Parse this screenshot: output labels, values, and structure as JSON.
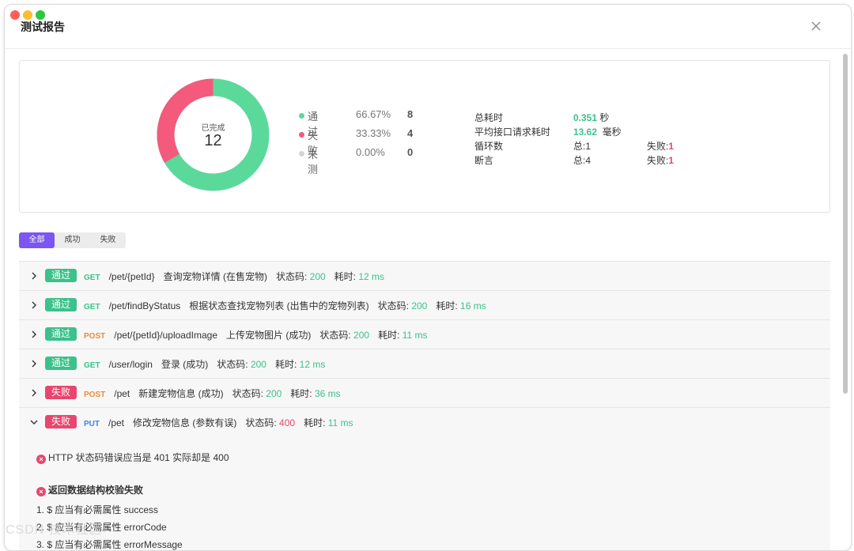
{
  "window": {
    "title": "测试报告"
  },
  "summary": {
    "center_label": "已完成",
    "center_value": "12",
    "legend": [
      {
        "name": "通过",
        "pct": "66.67%",
        "count": "8",
        "color": "#5bd99b"
      },
      {
        "name": "失败",
        "pct": "33.33%",
        "count": "4",
        "color": "#f35a7c"
      },
      {
        "name": "未测",
        "pct": "0.00%",
        "count": "0",
        "color": "#d4d4d4"
      }
    ],
    "stats": {
      "total_time_label": "总耗时",
      "total_time_value": "0.351",
      "total_time_unit": "秒",
      "avg_label": "平均接口请求耗时",
      "avg_value": "13.62",
      "avg_unit": "毫秒",
      "loops_label": "循环数",
      "loops_total": "总:1",
      "loops_fail_label": "失败:",
      "loops_fail_value": "1",
      "assert_label": "断言",
      "assert_total": "总:4",
      "assert_fail_label": "失败:",
      "assert_fail_value": "1"
    }
  },
  "filters": [
    "全部",
    "成功",
    "失败"
  ],
  "requests": [
    {
      "status": "通过",
      "method": "GET",
      "path": "/pet/{petId}",
      "desc": "查询宠物详情 (在售宠物)",
      "code_label": "状态码:",
      "code": "200",
      "time_label": "耗时:",
      "time": "12 ms"
    },
    {
      "status": "通过",
      "method": "GET",
      "path": "/pet/findByStatus",
      "desc": "根据状态查找宠物列表 (出售中的宠物列表)",
      "code_label": "状态码:",
      "code": "200",
      "time_label": "耗时:",
      "time": "16 ms"
    },
    {
      "status": "通过",
      "method": "POST",
      "path": "/pet/{petId}/uploadImage",
      "desc": "上传宠物图片 (成功)",
      "code_label": "状态码:",
      "code": "200",
      "time_label": "耗时:",
      "time": "11 ms"
    },
    {
      "status": "通过",
      "method": "GET",
      "path": "/user/login",
      "desc": "登录 (成功)",
      "code_label": "状态码:",
      "code": "200",
      "time_label": "耗时:",
      "time": "12 ms"
    },
    {
      "status": "失败",
      "method": "POST",
      "path": "/pet",
      "desc": "新建宠物信息 (成功)",
      "code_label": "状态码:",
      "code": "200",
      "time_label": "耗时:",
      "time": "36 ms"
    },
    {
      "status": "失败",
      "method": "PUT",
      "path": "/pet",
      "desc": "修改宠物信息 (参数有误)",
      "code_label": "状态码:",
      "code": "400",
      "time_label": "耗时:",
      "time": "11 ms"
    }
  ],
  "detail": {
    "http_error": "HTTP 状态码错误应当是 401 实际却是 400",
    "schema_error_title": "返回数据结构校验失败",
    "schema_errors": [
      "1. $ 应当有必需属性 success",
      "2. $ 应当有必需属性 errorCode",
      "3. $ 应当有必需属性 errorMessage"
    ]
  },
  "watermark": "CSDN 技术社区"
}
